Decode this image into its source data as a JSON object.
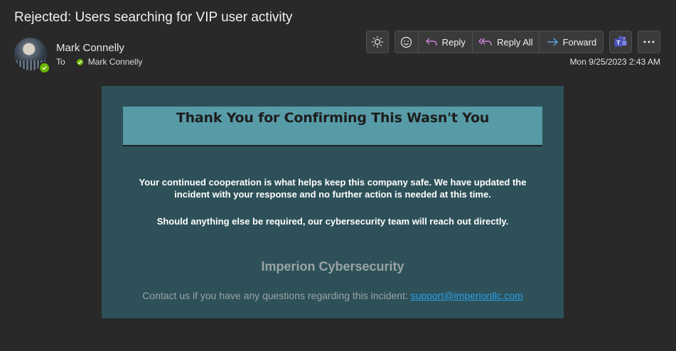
{
  "subject": "Rejected: Users searching for VIP user activity",
  "sender": {
    "name": "Mark Connelly",
    "to_label": "To",
    "recipient": "Mark Connelly"
  },
  "toolbar": {
    "reply_label": "Reply",
    "reply_all_label": "Reply All",
    "forward_label": "Forward"
  },
  "date": "Mon 9/25/2023 2:43 AM",
  "body": {
    "banner_title": "Thank You for Confirming This Wasn't You",
    "paragraph1_line1": "Your continued cooperation is what helps keep this company safe. We have updated the",
    "paragraph1_line2": "incident with your response and no further action is needed at this time.",
    "paragraph2": "Should anything else be required, our cybersecurity team will reach out directly.",
    "company": "Imperion Cybersecurity",
    "contact_text": "Contact us if you have any questions regarding this incident: ",
    "contact_email": "support@imperionllc.com"
  },
  "colors": {
    "background": "#292929",
    "body_bg": "#2e5159",
    "banner_bg": "#579ba7",
    "presence": "#6bb700",
    "link": "#2aa0e8"
  },
  "icons": [
    "brightness-icon",
    "emoji-icon",
    "reply-icon",
    "reply-all-icon",
    "forward-icon",
    "teams-icon",
    "more-icon",
    "presence-available-icon"
  ]
}
